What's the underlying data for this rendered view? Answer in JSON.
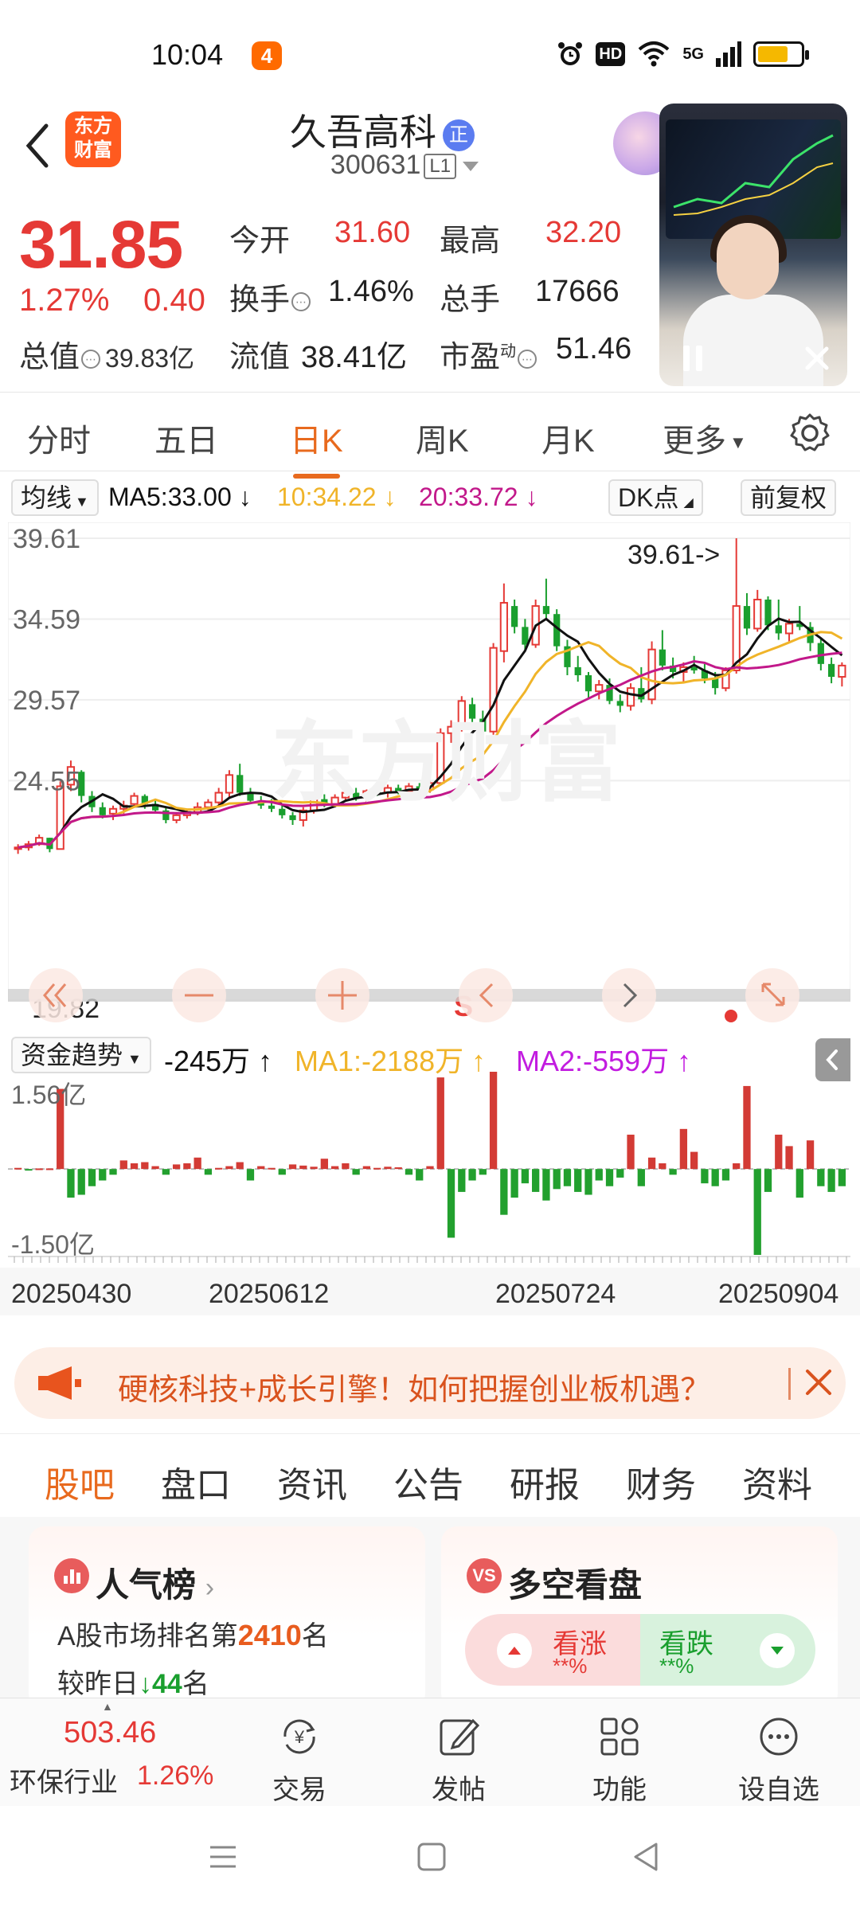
{
  "status_bar": {
    "time": "10:04",
    "network": "5G",
    "hd": "HD"
  },
  "header": {
    "logo_text": "东方财富",
    "stock_name": "久吾高科",
    "name_badge": "正",
    "stock_code": "300631",
    "level_badge": "L1"
  },
  "quote": {
    "price": "31.85",
    "change_pct": "1.27%",
    "change": "0.40",
    "total_value_label": "总值",
    "total_value": "39.83亿",
    "open_label": "今开",
    "open": "31.60",
    "high_label": "最高",
    "high": "32.20",
    "turnover_label": "换手",
    "turnover": "1.46%",
    "volume_label": "总手",
    "volume": "17666",
    "float_label": "流值",
    "float_value": "38.41亿",
    "pe_label": "市盈",
    "pe_sup": "动",
    "pe": "51.46"
  },
  "chart_tabs": [
    "分时",
    "五日",
    "日K",
    "周K",
    "月K",
    "更多"
  ],
  "active_chart_tab": "日K",
  "ma_bar": {
    "select": "均线",
    "ma5": "MA5:33.00",
    "ma10": "10:34.22",
    "ma20": "20:33.72",
    "dk": "DK点",
    "adjust": "前复权"
  },
  "colors": {
    "up": "#e53935",
    "down": "#1a9f2e",
    "ma5": "#111111",
    "ma10": "#f0b429",
    "ma20": "#c2188a",
    "accent": "#e86a1e"
  },
  "chart_data": [
    {
      "type": "candlestick",
      "axis_labels": [
        "39.61",
        "34.59",
        "29.57",
        "24.55"
      ],
      "ylim": [
        19.82,
        39.61
      ],
      "max_label": "39.61->",
      "min_label": "19.82",
      "marker": "S",
      "candles": [
        [
          20.3,
          20.6,
          20.0,
          20.4
        ],
        [
          20.4,
          20.8,
          20.2,
          20.6
        ],
        [
          20.6,
          21.2,
          20.5,
          21.0
        ],
        [
          21.0,
          21.0,
          20.1,
          20.3
        ],
        [
          20.3,
          24.5,
          20.3,
          24.2
        ],
        [
          24.3,
          25.8,
          23.9,
          25.4
        ],
        [
          25.1,
          25.2,
          23.2,
          23.6
        ],
        [
          23.6,
          23.9,
          22.6,
          22.9
        ],
        [
          22.9,
          23.2,
          22.2,
          22.4
        ],
        [
          22.5,
          23.0,
          22.1,
          22.8
        ],
        [
          22.8,
          23.3,
          22.5,
          23.0
        ],
        [
          23.1,
          23.8,
          22.9,
          23.6
        ],
        [
          23.6,
          23.7,
          22.8,
          23.1
        ],
        [
          23.1,
          23.4,
          22.5,
          22.7
        ],
        [
          22.7,
          22.9,
          21.9,
          22.1
        ],
        [
          22.1,
          22.6,
          21.9,
          22.4
        ],
        [
          22.4,
          22.8,
          22.2,
          22.6
        ],
        [
          22.6,
          23.2,
          22.4,
          22.9
        ],
        [
          22.9,
          23.4,
          22.6,
          23.2
        ],
        [
          23.2,
          24.1,
          22.9,
          23.8
        ],
        [
          23.8,
          25.2,
          23.5,
          24.9
        ],
        [
          24.9,
          25.6,
          23.6,
          23.8
        ],
        [
          23.8,
          24.1,
          23.1,
          23.3
        ],
        [
          23.3,
          23.6,
          22.8,
          23.0
        ],
        [
          23.0,
          23.4,
          22.6,
          22.8
        ],
        [
          22.8,
          23.0,
          22.2,
          22.4
        ],
        [
          22.4,
          22.6,
          21.8,
          22.1
        ],
        [
          22.1,
          22.9,
          21.7,
          22.7
        ],
        [
          22.7,
          23.6,
          22.5,
          23.4
        ],
        [
          23.4,
          23.7,
          22.9,
          23.1
        ],
        [
          23.1,
          23.7,
          22.9,
          23.5
        ],
        [
          23.5,
          24.0,
          23.3,
          23.8
        ],
        [
          23.8,
          24.1,
          23.3,
          23.5
        ],
        [
          23.5,
          24.0,
          23.2,
          23.9
        ],
        [
          23.9,
          24.2,
          23.6,
          23.8
        ],
        [
          23.8,
          24.3,
          23.5,
          24.1
        ],
        [
          24.1,
          24.3,
          23.7,
          23.9
        ],
        [
          23.9,
          24.4,
          23.6,
          24.2
        ],
        [
          24.2,
          24.4,
          23.8,
          24.0
        ],
        [
          24.0,
          24.6,
          23.8,
          24.4
        ],
        [
          24.4,
          27.8,
          24.3,
          27.5
        ],
        [
          27.5,
          28.3,
          26.9,
          27.9
        ],
        [
          27.9,
          29.8,
          27.6,
          29.5
        ],
        [
          29.3,
          29.7,
          28.1,
          28.4
        ],
        [
          28.4,
          28.9,
          27.2,
          27.6
        ],
        [
          27.6,
          33.1,
          27.4,
          32.8
        ],
        [
          32.6,
          36.8,
          31.9,
          35.6
        ],
        [
          35.4,
          35.8,
          33.7,
          34.1
        ],
        [
          34.1,
          34.6,
          32.6,
          33.0
        ],
        [
          33.0,
          35.8,
          32.8,
          35.4
        ],
        [
          35.4,
          37.1,
          34.6,
          34.9
        ],
        [
          34.9,
          35.2,
          32.6,
          32.9
        ],
        [
          32.9,
          33.3,
          31.1,
          31.6
        ],
        [
          31.6,
          32.3,
          30.7,
          31.1
        ],
        [
          31.1,
          31.3,
          29.7,
          30.1
        ],
        [
          30.1,
          30.8,
          29.6,
          30.5
        ],
        [
          30.5,
          30.9,
          29.3,
          29.5
        ],
        [
          29.5,
          29.9,
          28.8,
          29.2
        ],
        [
          29.2,
          30.6,
          28.9,
          30.3
        ],
        [
          30.3,
          31.6,
          29.4,
          29.6
        ],
        [
          29.6,
          33.2,
          29.3,
          32.7
        ],
        [
          32.7,
          33.9,
          31.4,
          31.7
        ],
        [
          31.7,
          32.2,
          30.9,
          31.3
        ],
        [
          31.3,
          31.9,
          30.7,
          31.6
        ],
        [
          31.6,
          32.3,
          31.2,
          31.4
        ],
        [
          31.4,
          31.8,
          30.6,
          30.9
        ],
        [
          30.9,
          31.3,
          29.9,
          30.3
        ],
        [
          30.3,
          31.6,
          30.1,
          31.4
        ],
        [
          31.4,
          39.61,
          31.2,
          35.4
        ],
        [
          35.4,
          36.2,
          33.6,
          34.0
        ],
        [
          34.0,
          36.4,
          33.8,
          35.8
        ],
        [
          35.8,
          36.0,
          33.9,
          34.2
        ],
        [
          34.2,
          35.8,
          33.3,
          33.7
        ],
        [
          33.7,
          34.6,
          33.1,
          34.3
        ],
        [
          34.3,
          35.4,
          33.9,
          34.1
        ],
        [
          34.1,
          34.4,
          32.6,
          33.1
        ],
        [
          33.1,
          33.4,
          31.4,
          31.8
        ],
        [
          31.8,
          32.2,
          30.6,
          31.0
        ],
        [
          31.0,
          31.9,
          30.4,
          31.7
        ]
      ]
    },
    {
      "type": "bar",
      "title": "资金趋势",
      "current": "-245万",
      "ma1": "MA1:-2188万",
      "ma2": "MA2:-559万",
      "axis_labels": [
        "1.56亿",
        "-1.50亿"
      ],
      "ylim": [
        -1.5,
        1.56
      ],
      "values": [
        0.02,
        -0.01,
        0.01,
        0.01,
        1.4,
        -0.5,
        -0.45,
        -0.3,
        -0.2,
        -0.1,
        0.15,
        0.1,
        0.12,
        0.05,
        -0.1,
        0.08,
        0.1,
        0.2,
        -0.1,
        0.02,
        0.05,
        0.12,
        -0.2,
        0.05,
        0.02,
        -0.1,
        0.08,
        0.06,
        0.04,
        0.18,
        0.05,
        0.1,
        -0.1,
        0.05,
        0.02,
        0.04,
        0.03,
        -0.1,
        -0.2,
        0.05,
        1.6,
        -1.2,
        -0.4,
        -0.2,
        -0.1,
        1.9,
        -0.8,
        -0.5,
        -0.25,
        -0.4,
        -0.55,
        -0.35,
        -0.3,
        -0.4,
        -0.45,
        -0.2,
        -0.3,
        -0.15,
        0.6,
        -0.3,
        0.2,
        0.1,
        -0.1,
        0.7,
        0.3,
        -0.25,
        -0.3,
        -0.2,
        0.1,
        1.45,
        -1.5,
        -0.4,
        0.6,
        0.4,
        -0.5,
        0.5,
        -0.3,
        -0.4,
        -0.3
      ]
    }
  ],
  "date_axis": [
    "20250430",
    "20250612",
    "20250724",
    "20250904"
  ],
  "banner": {
    "text": "硬核科技+成长引擎！如何把握创业板机遇？"
  },
  "section_tabs": [
    "股吧",
    "盘口",
    "资讯",
    "公告",
    "研报",
    "财务",
    "资料"
  ],
  "active_section_tab": "股吧",
  "popularity": {
    "title": "人气榜",
    "line1_prefix": "A股市场排名第",
    "rank": "2410",
    "line1_suffix": "名",
    "line2_prefix": "较昨日",
    "delta": "44",
    "line2_suffix": "名"
  },
  "sentiment": {
    "title": "多空看盘",
    "icon_text": "VS",
    "bull_label": "看涨",
    "bull_value": "**%",
    "bear_label": "看跌",
    "bear_value": "**%"
  },
  "bottom_nav": {
    "index_value": "503.46",
    "index_name": "环保行业",
    "index_pct": "1.26%",
    "items": [
      "交易",
      "发帖",
      "功能",
      "设自选"
    ]
  }
}
